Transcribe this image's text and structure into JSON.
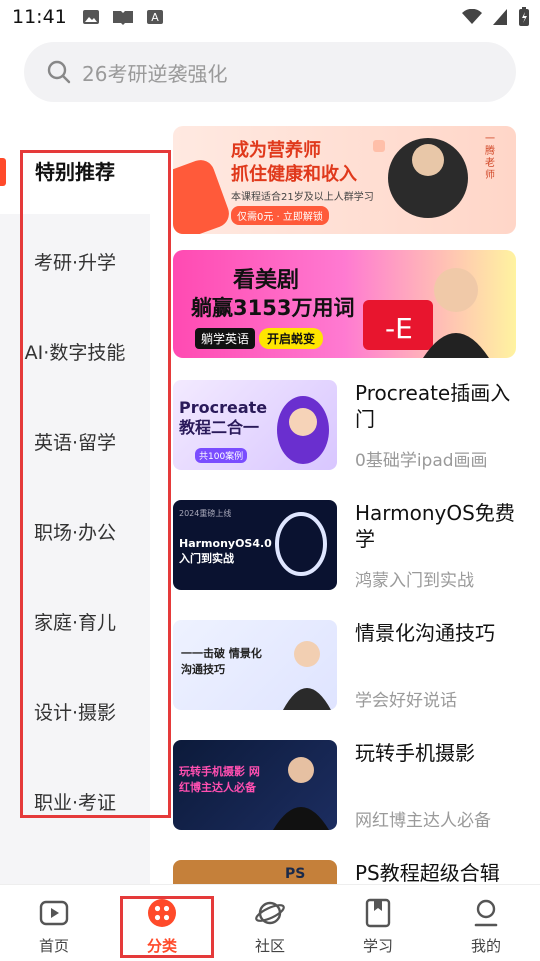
{
  "status_bar": {
    "time": "11:41"
  },
  "search": {
    "placeholder": "26考研逆袭强化"
  },
  "sidebar": {
    "items": [
      {
        "label": "特别推荐",
        "active": true
      },
      {
        "label": "考研·升学"
      },
      {
        "label": "AI·数字技能"
      },
      {
        "label": "英语·留学"
      },
      {
        "label": "职场·办公"
      },
      {
        "label": "家庭·育儿"
      },
      {
        "label": "设计·摄影"
      },
      {
        "label": "职业·考证"
      }
    ]
  },
  "banners": [
    {
      "headline1": "成为营养师",
      "headline2": "抓住健康和收入",
      "sub": "本课程适合21岁及以上人群学习",
      "cta": "仅需0元 · 立即解锁",
      "side": "一腾老师"
    },
    {
      "headline1": "看美剧",
      "headline2": "躺赢3153万用词",
      "tag": "躺学英语",
      "cta": "开启蜕变"
    }
  ],
  "courses": [
    {
      "title": "Procreate插画入门",
      "subtitle": "0基础学ipad画画",
      "thumb_text": "Procreate 教程二合一",
      "thumb_sub": "共100案例"
    },
    {
      "title": "HarmonyOS免费学",
      "subtitle": "鸿蒙入门到实战",
      "thumb_text": "HarmonyOS4.0 入门到实战",
      "thumb_top": "2024重磅上线"
    },
    {
      "title": "情景化沟通技巧",
      "subtitle": "学会好好说话",
      "thumb_text": "一一击破 情景化沟通技巧"
    },
    {
      "title": "玩转手机摄影",
      "subtitle": "网红博主达人必备",
      "thumb_text": "玩转手机摄影 网红博主达人必备"
    },
    {
      "title": "PS教程超级合辑",
      "subtitle": "",
      "thumb_text": "PS"
    }
  ],
  "bottom_nav": [
    {
      "label": "首页",
      "icon": "play-square-icon"
    },
    {
      "label": "分类",
      "icon": "grid-dots-icon",
      "active": true
    },
    {
      "label": "社区",
      "icon": "planet-icon"
    },
    {
      "label": "学习",
      "icon": "bookmark-book-icon"
    },
    {
      "label": "我的",
      "icon": "person-icon"
    }
  ],
  "colors": {
    "accent": "#ff4a2a",
    "highlight": "#e53a3a"
  }
}
